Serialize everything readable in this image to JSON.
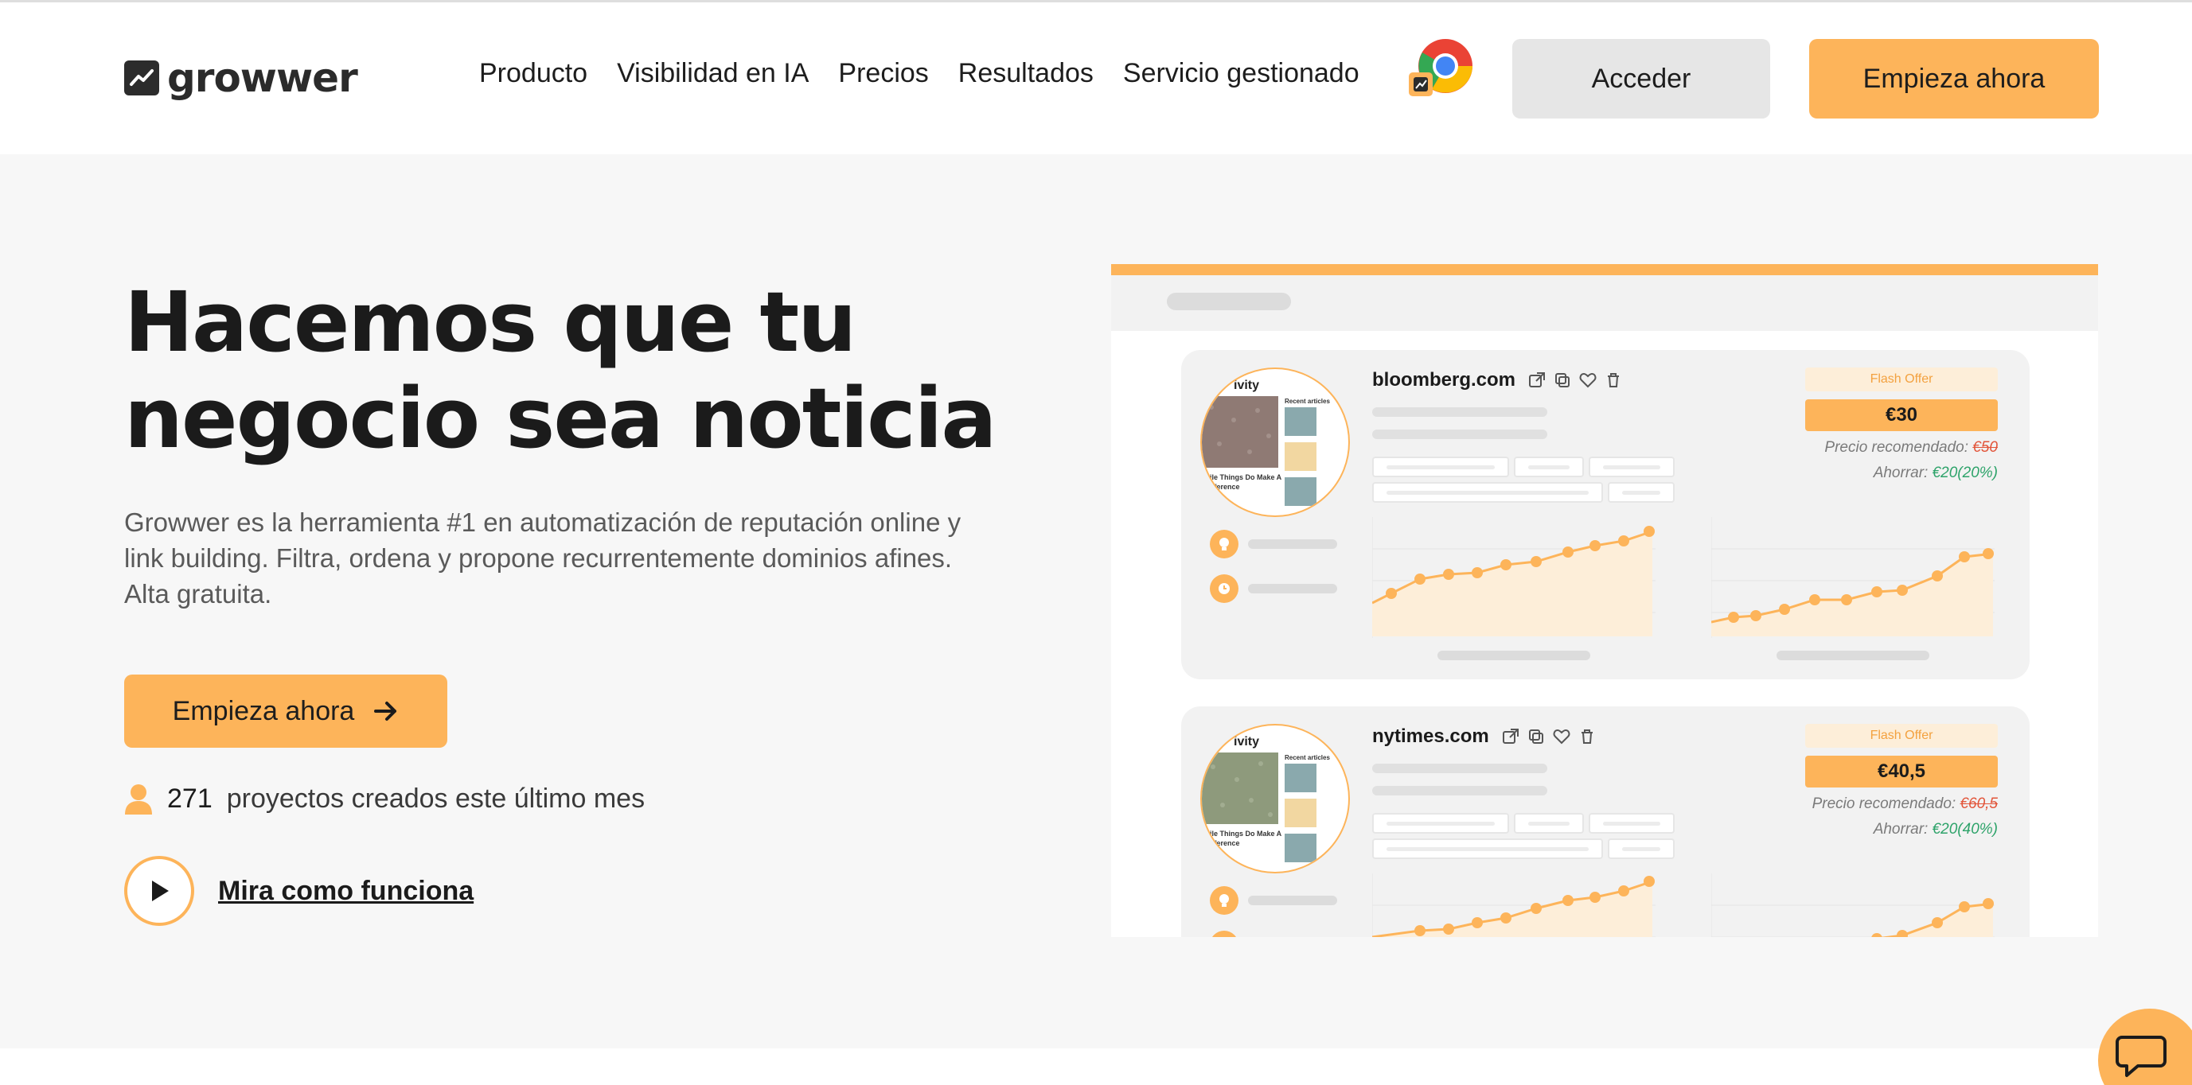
{
  "header": {
    "logo_text": "growwer",
    "nav": [
      "Producto",
      "Visibilidad en IA",
      "Precios",
      "Resultados",
      "Servicio gestionado"
    ],
    "login_label": "Acceder",
    "start_label": "Empieza ahora"
  },
  "hero": {
    "title_line1": "Hacemos que tu",
    "title_line2": "negocio sea noticia",
    "description": "Growwer es la herramienta #1 en automatización de reputación online y link building. Filtra, ordena y propone recurrentemente dominios afines. Alta gratuita.",
    "cta_label": "Empieza ahora",
    "projects_count": "271",
    "projects_label": "proyectos creados este último mes",
    "watch_label": "Mira como funciona"
  },
  "cards": [
    {
      "domain": "bloomberg.com",
      "thumb_title": "ivity",
      "thumb_recent": "Recent articles",
      "thumb_caption": "ile Things Do Make A ifference",
      "flash": "Flash Offer",
      "price": "€30",
      "recommended_label": "Precio recomendado:",
      "recommended_old": "€50",
      "save_label": "Ahorrar:",
      "save_amount": "€20(20%)"
    },
    {
      "domain": "nytimes.com",
      "thumb_title": "ivity",
      "thumb_recent": "Recent articles",
      "thumb_caption": "ile Things Do Make A ifference",
      "flash": "Flash Offer",
      "price": "€40,5",
      "recommended_label": "Precio recomendado:",
      "recommended_old": "€60,5",
      "save_label": "Ahorrar:",
      "save_amount": "€20(40%)"
    }
  ],
  "colors": {
    "accent": "#fdb45a",
    "save_green": "#2ea36a",
    "old_price_red": "#e2553a",
    "page_bg": "#f7f7f7"
  },
  "icons": {
    "logo": "chart-trend-icon",
    "extension": "chrome-icon",
    "cta_arrow": "arrow-right-icon",
    "user": "user-icon",
    "play": "play-icon",
    "chat": "chat-icon",
    "card_actions": [
      "external-link-icon",
      "copy-icon",
      "heart-icon",
      "trash-icon"
    ],
    "card_rows": [
      "lightbulb-icon",
      "clock-icon"
    ]
  }
}
